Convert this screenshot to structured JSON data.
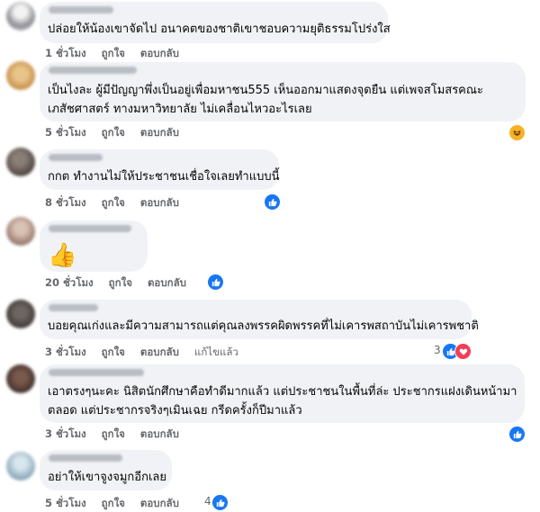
{
  "comments": [
    {
      "id": "c1",
      "lines": [
        "ปล่อยให้น้องเขาจัดไป อนาคตของชาติเขาชอบความยุติธรรมโปร่งใส"
      ],
      "time": "1 ชั่วโมง",
      "like": "ถูกใจ",
      "reply": "ตอบกลับ"
    },
    {
      "id": "c2",
      "lines": [
        "เป็นไงละ ผู้มีปัญญาพึ่งเป็นอยู่เพื่อมหาชน555 เห็นออกมาแสดงจุดยืน แต่เพจสโมสรคณะ",
        "เภสัชศาสตร์ ทางมหาวิทยาลัย ไม่เคลื่อนไหวอะไรเลย"
      ],
      "time": "5 ชั่วโมง",
      "like": "ถูกใจ",
      "reply": "ตอบกลับ",
      "reaction": "haha-icon"
    },
    {
      "id": "c3",
      "lines": [
        "กกต ทำงานไม่ให้ประชาชนเชื่อใจเลยทำแบบนี้"
      ],
      "time": "8 ชั่วโมง",
      "like": "ถูกใจ",
      "reply": "ตอบกลับ",
      "reaction": "like-icon"
    },
    {
      "id": "c4",
      "emoji": "👍",
      "time": "20 ชั่วโมง",
      "like": "ถูกใจ",
      "reply": "ตอบกลับ",
      "reaction": "like-icon"
    },
    {
      "id": "c5",
      "lines": [
        "บอยคุณเก่งและมีความสามารถแต่คุณลงพรรคผิดพรรคที่ไม่เคารพสถาบันไม่เคารพชาติ"
      ],
      "time": "3 ชั่วโมง",
      "like": "ถูกใจ",
      "reply": "ตอบกลับ",
      "edited": "แก้ไขแล้ว",
      "reaction_count": "3",
      "reaction": "like-love-icons"
    },
    {
      "id": "c6",
      "lines": [
        "เอาตรงๆนะคะ นิสิตนักศึกษาคือทำดีมากแล้ว แต่ประชาชนในพื้นที่ล่ะ ประชากรแฝงเดินหน้ามา",
        "ตลอด แต่ประชากรจริงๆเมินเฉย กรีดครั้งก็ปีมาแล้ว"
      ],
      "time": "3 ชั่วโมง",
      "like": "ถูกใจ",
      "reply": "ตอบกลับ",
      "reaction": "like-icon"
    },
    {
      "id": "c7",
      "lines": [
        "อย่าให้เขาจูงจมูกอีกเลย"
      ],
      "time": "5 ชั่วโมง",
      "like": "ถูกใจ",
      "reply": "ตอบกลับ",
      "reaction_count": "4",
      "reaction": "like-icon"
    }
  ],
  "colors": {
    "bubble": "#f0f2f5",
    "like": "#1877f2",
    "love": "#f33e58",
    "meta": "#65676b"
  }
}
